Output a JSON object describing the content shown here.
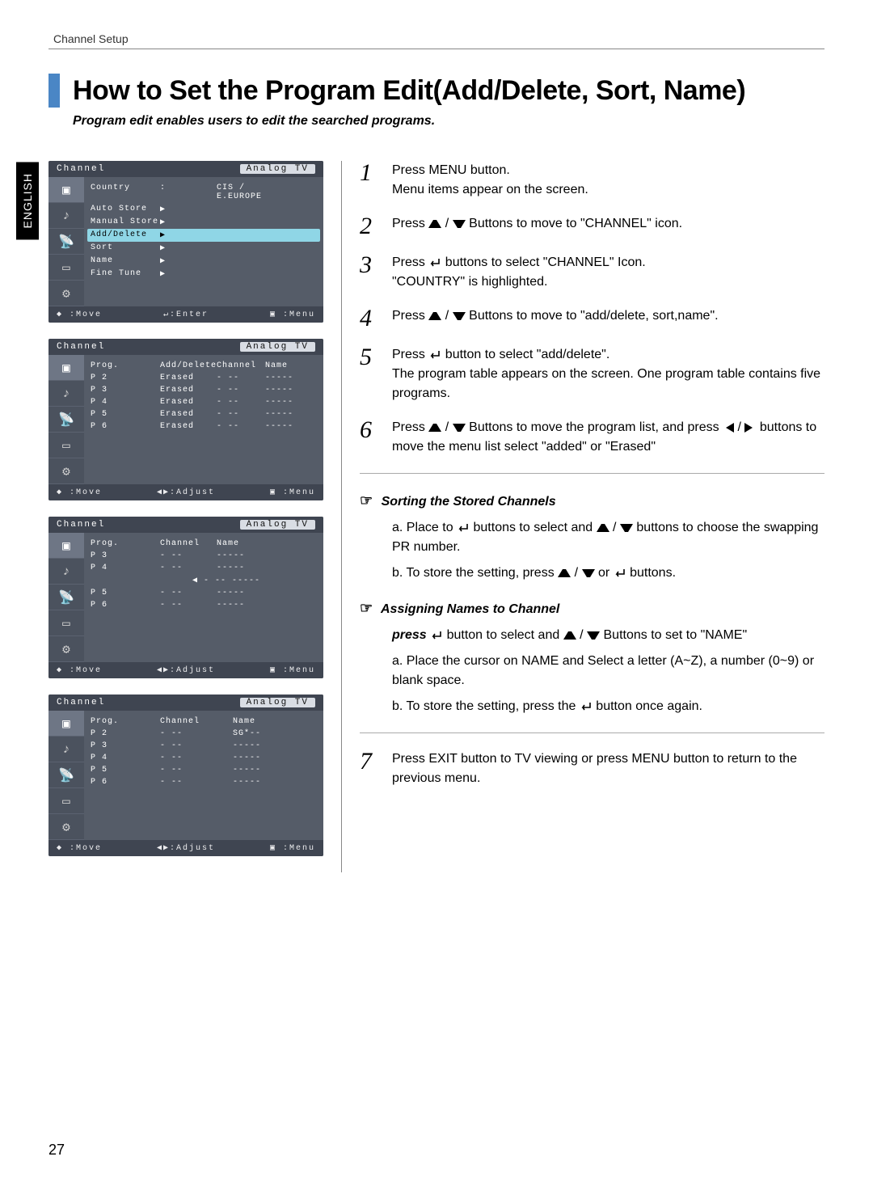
{
  "header": {
    "section": "Channel Setup"
  },
  "language_tab": "ENGLISH",
  "title": "How to Set the Program Edit(Add/Delete, Sort, Name)",
  "subtitle": "Program edit enables users to edit the searched programs.",
  "page_number": "27",
  "osd_common": {
    "header_left": "Channel",
    "header_right": "Analog TV",
    "icons": [
      "picture-icon",
      "sound-icon",
      "channel-icon",
      "feature-icon",
      "setup-icon"
    ]
  },
  "osd1": {
    "rows": [
      {
        "label": "Country",
        "value": "CIS / E.EUROPE",
        "hl": false,
        "ind": ":"
      },
      {
        "label": "Auto Store",
        "value": "",
        "hl": false,
        "ind": "▶"
      },
      {
        "label": "Manual Store",
        "value": "",
        "hl": false,
        "ind": "▶"
      },
      {
        "label": "Add/Delete",
        "value": "",
        "hl": true,
        "ind": "▶"
      },
      {
        "label": "Sort",
        "value": "",
        "hl": false,
        "ind": "▶"
      },
      {
        "label": "Name",
        "value": "",
        "hl": false,
        "ind": "▶"
      },
      {
        "label": "Fine Tune",
        "value": "",
        "hl": false,
        "ind": "▶"
      }
    ],
    "footer": {
      "left": "◆ :Move",
      "center": "↵:Enter",
      "right": "▣ :Menu"
    }
  },
  "osd2": {
    "headers": [
      "Prog.",
      "Add/Delete",
      "Channel",
      "Name"
    ],
    "rows": [
      {
        "prog": "P  2",
        "ad": "Erased",
        "ch": "- --",
        "name": "-----"
      },
      {
        "prog": "P  3",
        "ad": "Erased",
        "ch": "- --",
        "name": "-----"
      },
      {
        "prog": "P  4",
        "ad": "Erased",
        "ch": "- --",
        "name": "-----"
      },
      {
        "prog": "P  5",
        "ad": "Erased",
        "ch": "- --",
        "name": "-----"
      },
      {
        "prog": "P  6",
        "ad": "Erased",
        "ch": "- --",
        "name": "-----"
      }
    ],
    "footer": {
      "left": "◆ :Move",
      "center": "◀▶:Adjust",
      "right": "▣ :Menu"
    }
  },
  "osd3": {
    "headers": [
      "Prog.",
      "Channel",
      "Name"
    ],
    "rows": [
      {
        "prog": "P  3",
        "ch": "- --",
        "name": "-----"
      },
      {
        "prog": "P  4",
        "ch": "- --",
        "name": "-----"
      },
      {
        "prog": "P  5",
        "ch": "- --",
        "name": "-----"
      },
      {
        "prog": "P  6",
        "ch": "- --",
        "name": "-----"
      }
    ],
    "swap": "◀  - --   -----",
    "footer": {
      "left": "◆ :Move",
      "center": "◀▶:Adjust",
      "right": "▣ :Menu"
    }
  },
  "osd4": {
    "headers": [
      "Prog.",
      "Channel",
      "Name"
    ],
    "rows": [
      {
        "prog": "P  2",
        "ch": "- --",
        "name": "SG*--"
      },
      {
        "prog": "P  3",
        "ch": "- --",
        "name": "-----"
      },
      {
        "prog": "P  4",
        "ch": "- --",
        "name": "-----"
      },
      {
        "prog": "P  5",
        "ch": "- --",
        "name": "-----"
      },
      {
        "prog": "P  6",
        "ch": "- --",
        "name": "-----"
      }
    ],
    "footer": {
      "left": "◆ :Move",
      "center": "◀▶:Adjust",
      "right": "▣ :Menu"
    }
  },
  "steps": {
    "s1a": "Press MENU button.",
    "s1b": "Menu items appear on the screen.",
    "s2_pre": "Press ",
    "s2_post": " Buttons to move to \"CHANNEL\" icon.",
    "s3a_pre": "Press ",
    "s3a_post": " buttons to select \"CHANNEL\" Icon.",
    "s3b": "\"COUNTRY\" is highlighted.",
    "s4_pre": "Press ",
    "s4_post": " Buttons to move to \"add/delete, sort,name\".",
    "s5a_pre": "Press ",
    "s5a_post": " button to select \"add/delete\".",
    "s5b": "The program  table appears on the screen. One program table contains five programs.",
    "s6_pre": "Press ",
    "s6_mid": " Buttons to move the program list, and press ",
    "s6_post": " buttons to move the menu list select \"added\" or \"Erased\"",
    "sorting_head": "Sorting the Stored Channels",
    "sort_a_pre": "a. Place to ",
    "sort_a_mid": " buttons to select and ",
    "sort_a_post": " buttons to choose the swapping PR number.",
    "sort_b_pre": "b. To store the setting, press ",
    "sort_b_mid": " or ",
    "sort_b_post": " buttons.",
    "assign_head": "Assigning Names to Channel",
    "assign_press_pre": "press ",
    "assign_press_mid": " button to select and ",
    "assign_press_post": " Buttons to set to \"NAME\"",
    "assign_a": "a. Place the cursor on NAME and  Select a letter (A~Z), a number (0~9) or blank space.",
    "assign_b_pre": "b. To store the setting, press the ",
    "assign_b_post": " button once again.",
    "s7": "Press EXIT button to TV viewing or press MENU button to return to the previous menu."
  }
}
